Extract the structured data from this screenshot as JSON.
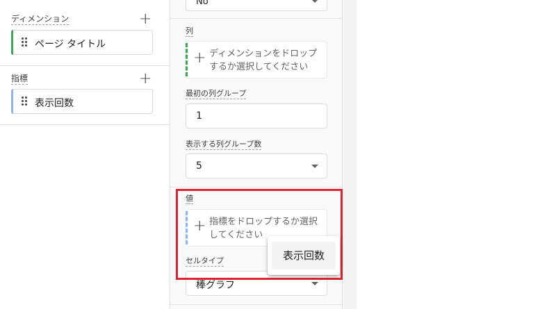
{
  "variables": {
    "dimensions": {
      "title": "ディメンション",
      "add_icon": "plus-icon",
      "items": [
        {
          "label": "ページ タイトル",
          "color": "#34a853"
        }
      ]
    },
    "metrics": {
      "title": "指標",
      "add_icon": "plus-icon",
      "items": [
        {
          "label": "表示回数",
          "color": "#8ab4f8"
        }
      ]
    }
  },
  "settings": {
    "top_select": {
      "value": "No"
    },
    "columns": {
      "label": "列",
      "drop_text": "ディメンションをドロップするか選択してください",
      "accent": "#34a853"
    },
    "first_column_group": {
      "label": "最初の列グループ",
      "value": "1"
    },
    "column_groups_shown": {
      "label": "表示する列グループ数",
      "value": "5"
    },
    "values": {
      "label": "値",
      "drop_text": "指標をドロップするか選択してください",
      "accent": "#8ab4f8"
    },
    "cell_type": {
      "label": "セルタイプ",
      "value": "棒グラフ"
    }
  },
  "popup": {
    "item_label": "表示回数"
  },
  "highlight_color": "#e0232e"
}
